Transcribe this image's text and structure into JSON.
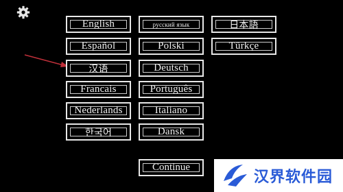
{
  "colors": {
    "background": "#000000",
    "button_border": "#e8e8e8",
    "button_text": "#f2f2f2",
    "arrow": "#c0303a",
    "watermark_blue": "#2a5bd7"
  },
  "settings": {
    "icon": "gear-icon"
  },
  "languages": {
    "col1": [
      "English",
      "Español",
      "汉语",
      "Francais",
      "Nederlands",
      "한국어"
    ],
    "col2": [
      "русский язык",
      "Polski",
      "Deutsch",
      "Português",
      "Italiano",
      "Dansk"
    ],
    "col3": [
      "日本語",
      "Türkçe"
    ]
  },
  "continue_label": "Continue",
  "watermark": {
    "text": "汉界软件园"
  }
}
